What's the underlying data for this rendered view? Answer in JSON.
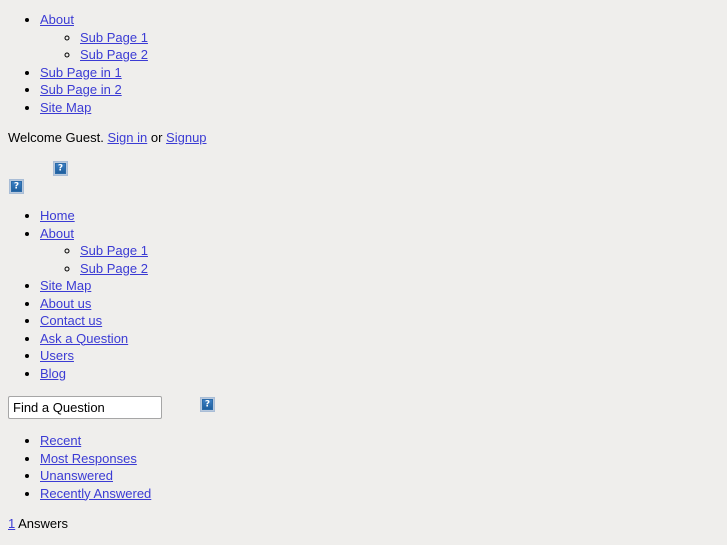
{
  "page": {
    "background_color": "#efeeec",
    "link_color": "#3b3bd4",
    "text_color": "#000000"
  },
  "top_nav": {
    "items": [
      {
        "label": "About",
        "children": [
          {
            "label": "Sub Page 1"
          },
          {
            "label": "Sub Page 2"
          }
        ]
      },
      {
        "label": "Sub Page in 1"
      },
      {
        "label": "Sub Page in 2"
      },
      {
        "label": "Site Map"
      }
    ]
  },
  "welcome": {
    "prefix": "Welcome Guest.",
    "sign_in_label": "Sign in",
    "separator": "or",
    "signup_label": "Signup"
  },
  "branding": {
    "logo_icon": "broken-image-icon",
    "banner_icon": "broken-image-icon"
  },
  "main_nav": {
    "items": [
      {
        "label": "Home"
      },
      {
        "label": "About",
        "children": [
          {
            "label": "Sub Page 1"
          },
          {
            "label": "Sub Page 2"
          }
        ]
      },
      {
        "label": "Site Map"
      },
      {
        "label": "About us"
      },
      {
        "label": "Contact us"
      },
      {
        "label": "Ask a Question"
      },
      {
        "label": "Users"
      },
      {
        "label": "Blog"
      }
    ]
  },
  "search": {
    "value": "Find a Question",
    "placeholder": "Find a Question",
    "button_icon": "broken-image-icon"
  },
  "filter_tabs": {
    "items": [
      {
        "label": "Recent"
      },
      {
        "label": "Most Responses"
      },
      {
        "label": "Unanswered"
      },
      {
        "label": "Recently Answered"
      }
    ]
  },
  "answers_summary": {
    "count": "1",
    "label": "Answers"
  }
}
